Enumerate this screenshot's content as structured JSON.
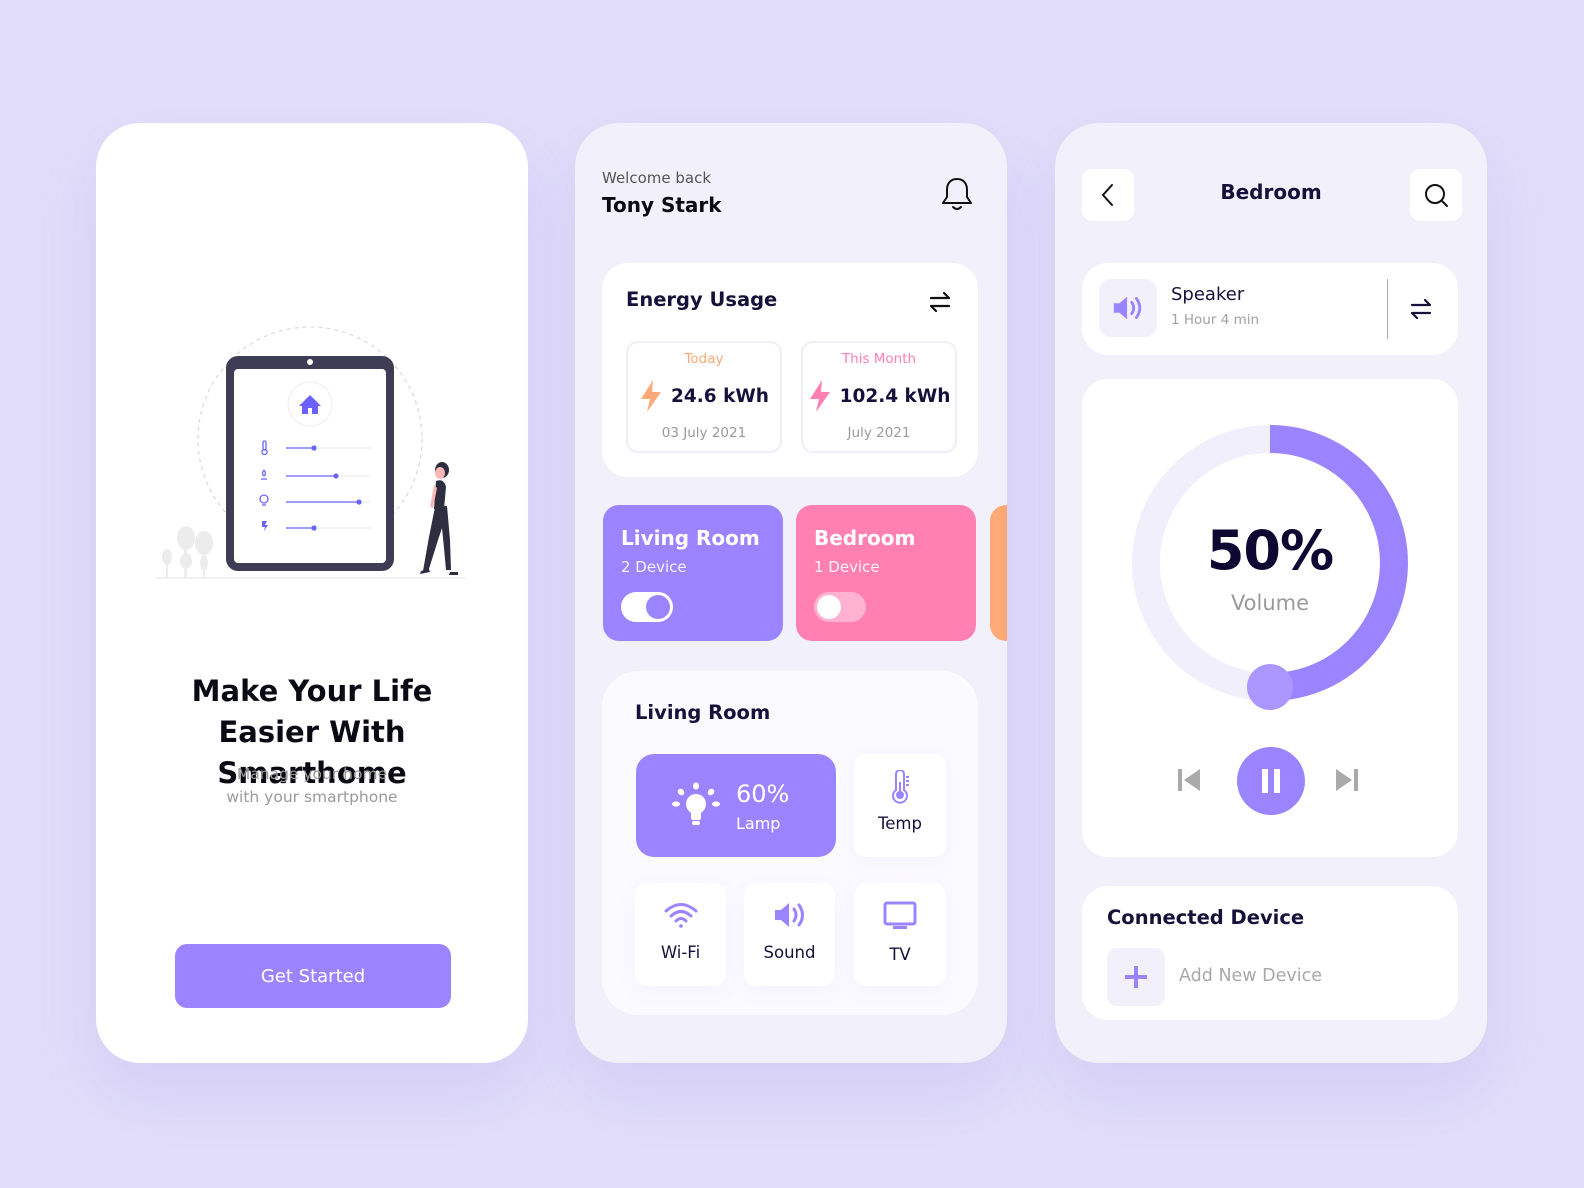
{
  "colors": {
    "background": "#e1ddf9",
    "accent_purple": "#9b84ff",
    "accent_pink": "#ff80b1",
    "accent_orange": "#ffa978",
    "text_dark": "#15113a",
    "text_muted": "#9a9a9a"
  },
  "onboarding": {
    "illustration": "tablet-smarthome-illustration",
    "title": "Make Your Life Easier With Smarthome",
    "subtitle_line1": "Manage your home",
    "subtitle_line2": "with your smartphone",
    "cta_label": "Get Started"
  },
  "dashboard": {
    "welcome": "Welcome back",
    "user_name": "Tony Stark",
    "notification_icon": "bell-icon",
    "energy": {
      "title": "Energy Usage",
      "toggle_icon": "swap-arrows-icon",
      "today": {
        "label": "Today",
        "value": "24.6 kWh",
        "date": "03 July 2021",
        "color": "#ffa978"
      },
      "month": {
        "label": "This Month",
        "value": "102.4 kWh",
        "date": "July 2021",
        "color": "#ff80b1"
      }
    },
    "rooms": [
      {
        "name": "Living Room",
        "devices": "2 Device",
        "on": true,
        "color": "#9b84ff"
      },
      {
        "name": "Bedroom",
        "devices": "1 Device",
        "on": false,
        "color": "#ff80b1"
      },
      {
        "name": "",
        "devices": "",
        "color": "#ffa978"
      }
    ],
    "living_room": {
      "title": "Living Room",
      "lamp": {
        "value": "60%",
        "label": "Lamp",
        "icon": "lightbulb-icon"
      },
      "devices": [
        {
          "label": "Temp",
          "icon": "thermometer-icon"
        },
        {
          "label": "Wi-Fi",
          "icon": "wifi-icon"
        },
        {
          "label": "Sound",
          "icon": "speaker-icon"
        },
        {
          "label": "TV",
          "icon": "tv-icon"
        }
      ]
    }
  },
  "bedroom": {
    "title": "Bedroom",
    "back_icon": "chevron-left-icon",
    "search_icon": "search-icon",
    "speaker": {
      "name": "Speaker",
      "duration": "1 Hour 4 min"
    },
    "volume": {
      "percent": 50,
      "display": "50%",
      "label": "Volume"
    },
    "controls": [
      "skip-previous",
      "pause",
      "skip-next"
    ],
    "connected": {
      "title": "Connected Device",
      "add_label": "Add New Device"
    }
  }
}
